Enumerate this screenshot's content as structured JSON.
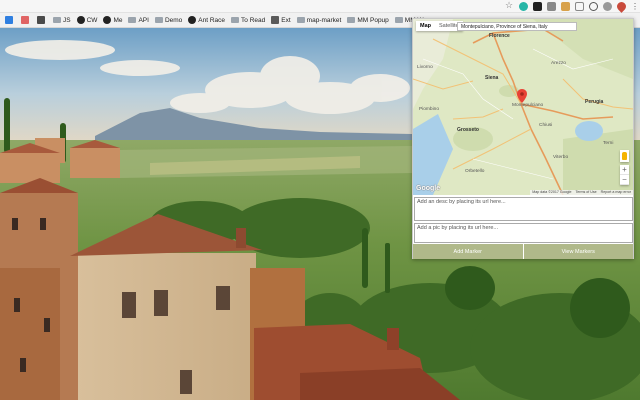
{
  "browser": {
    "extensions": [
      {
        "icon": "teal-circle-extension-icon",
        "color": "#26b5a6"
      },
      {
        "icon": "dark-square-extension-icon",
        "color": "#222222"
      },
      {
        "icon": "gray-square-extension-icon",
        "color": "#888888"
      },
      {
        "icon": "striped-extension-icon",
        "color": "#d8a14a"
      },
      {
        "icon": "outline-square-extension-icon",
        "color": "#aaaaaa"
      },
      {
        "icon": "circle-slash-extension-icon",
        "color": "#555555"
      },
      {
        "icon": "gray-circle-extension-icon",
        "color": "#999999"
      },
      {
        "icon": "map-marker-extension-icon",
        "color": "#c94a3b"
      }
    ],
    "bookmarks": [
      {
        "icon": "finder-icon",
        "label": ""
      },
      {
        "icon": "grid-icon",
        "label": ""
      },
      {
        "icon": "shield-icon",
        "label": ""
      },
      {
        "icon": "js-icon",
        "label": "JS"
      },
      {
        "icon": "github-icon",
        "label": "CW"
      },
      {
        "icon": "github-icon",
        "label": "Me"
      },
      {
        "icon": "folder-icon",
        "label": "API"
      },
      {
        "icon": "folder-icon",
        "label": "Demo"
      },
      {
        "icon": "github-icon",
        "label": "Ant Race"
      },
      {
        "icon": "folder-icon",
        "label": "To Read"
      },
      {
        "icon": "extension-puzzle-icon",
        "label": "Ext"
      },
      {
        "icon": "folder-icon",
        "label": "map-market"
      },
      {
        "icon": "folder-icon",
        "label": "MM Popup"
      },
      {
        "icon": "folder-icon",
        "label": "MM W"
      }
    ]
  },
  "popup": {
    "map": {
      "type_tabs": [
        "Map",
        "Satellite"
      ],
      "active_tab": "Map",
      "search_value": "Montepulciano, Province of Siena, Italy",
      "places": [
        {
          "name": "Florence",
          "kind": "city"
        },
        {
          "name": "Arezzo",
          "kind": "town"
        },
        {
          "name": "Siena",
          "kind": "city"
        },
        {
          "name": "Montepulciano",
          "kind": "town"
        },
        {
          "name": "Perugia",
          "kind": "city"
        },
        {
          "name": "Grosseto",
          "kind": "city"
        },
        {
          "name": "Orbetello",
          "kind": "town"
        },
        {
          "name": "Terni",
          "kind": "town"
        },
        {
          "name": "Viterbo",
          "kind": "town"
        },
        {
          "name": "Piombino",
          "kind": "town"
        },
        {
          "name": "Chiusi",
          "kind": "town"
        },
        {
          "name": "Livorno",
          "kind": "town"
        }
      ],
      "zoom_in": "+",
      "zoom_out": "−",
      "google_logo": "Google",
      "footer": [
        "Map data ©2017 Google",
        "Terms of Use",
        "Report a map error"
      ],
      "marker_color": "#e84235"
    },
    "desc_placeholder": "Add an desc by placing its url here...",
    "pic_placeholder": "Add a pic by placing its url here...",
    "buttons": {
      "add": "Add Marker",
      "view": "View Markers"
    },
    "button_color": "#b0b98a"
  }
}
